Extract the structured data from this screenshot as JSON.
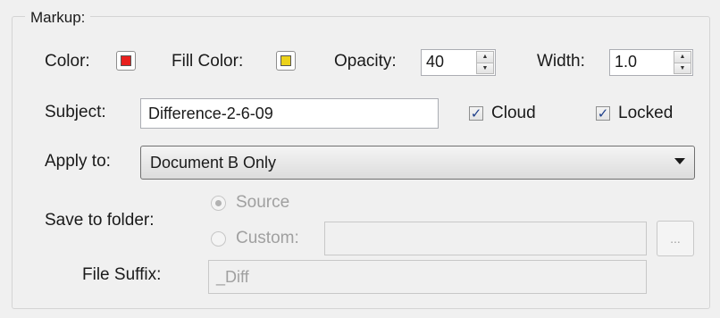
{
  "markup": {
    "group_label": "Markup:",
    "color": {
      "label": "Color:",
      "value": "#e8201e"
    },
    "fill_color": {
      "label": "Fill Color:",
      "value": "#ecd21a"
    },
    "opacity": {
      "label": "Opacity:",
      "value": "40"
    },
    "width": {
      "label": "Width:",
      "value": "1.0"
    },
    "subject": {
      "label": "Subject:",
      "value": "Difference-2-6-09"
    },
    "cloud": {
      "label": "Cloud",
      "checked": true
    },
    "locked": {
      "label": "Locked",
      "checked": true
    },
    "apply_to": {
      "label": "Apply to:",
      "value": "Document B Only"
    },
    "save_to_folder": {
      "label": "Save to folder:",
      "source_label": "Source",
      "custom_label": "Custom:",
      "custom_value": "",
      "browse_label": "..."
    },
    "file_suffix": {
      "label": "File Suffix:",
      "value": "_Diff"
    }
  }
}
